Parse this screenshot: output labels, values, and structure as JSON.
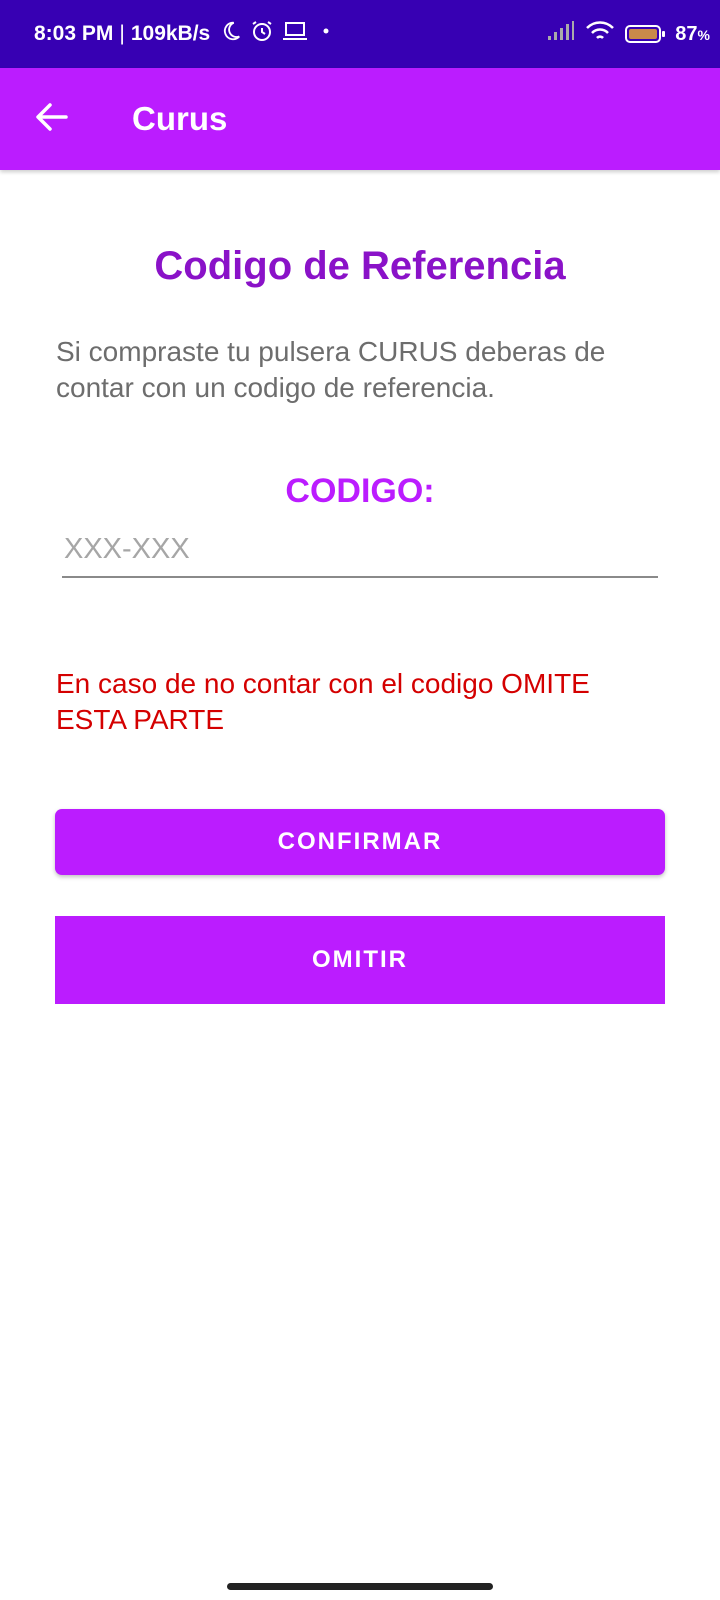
{
  "status_bar": {
    "time": "8:03 PM",
    "separator": "|",
    "speed": "109kB/s",
    "battery": "87",
    "battery_unit": "%",
    "icons": [
      "moon-icon",
      "alarm-icon",
      "laptop-icon",
      "dot-icon",
      "signal-icon",
      "wifi-icon",
      "battery-icon"
    ]
  },
  "app_bar": {
    "title": "Curus",
    "back_icon": "arrow-left-icon"
  },
  "main": {
    "heading": "Codigo de Referencia",
    "description": "Si compraste tu pulsera CURUS deberas de contar con un codigo de referencia.",
    "code_label": "CODIGO:",
    "code_input": {
      "value": "",
      "placeholder": "XXX-XXX"
    },
    "warning": "En caso de no contar con el codigo OMITE ESTA PARTE",
    "confirm_label": "CONFIRMAR",
    "omit_label": "OMITIR"
  },
  "colors": {
    "status_bar": "#3700b3",
    "app_bar": "#bb1cff",
    "heading": "#8a12c8",
    "label": "#bb1cff",
    "warning": "#d40000",
    "button": "#bb1cff"
  }
}
